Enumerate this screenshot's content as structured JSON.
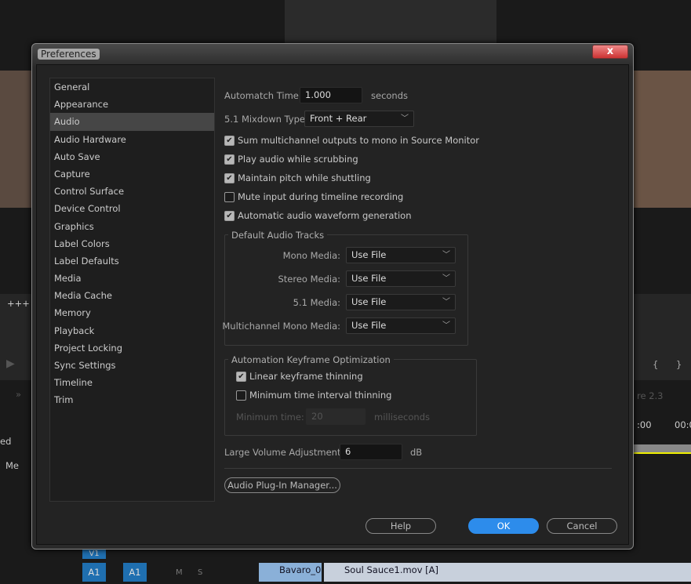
{
  "background": {
    "left_label": "ed",
    "column_header": "Me",
    "sequence_label": "re 2.3",
    "timecode1": ":00",
    "timecode2": "00:0",
    "track_a1": "A1",
    "track_a1_target": "A1",
    "track_v1": "V1",
    "mute": "M",
    "solo": "S",
    "clip1": "Bavaro_0",
    "clip2": "Soul Sauce1.mov [A]"
  },
  "dialog": {
    "title": "Preferences",
    "close": "x"
  },
  "sidebar": {
    "items": [
      "General",
      "Appearance",
      "Audio",
      "Audio Hardware",
      "Auto Save",
      "Capture",
      "Control Surface",
      "Device Control",
      "Graphics",
      "Label Colors",
      "Label Defaults",
      "Media",
      "Media Cache",
      "Memory",
      "Playback",
      "Project Locking",
      "Sync Settings",
      "Timeline",
      "Trim"
    ],
    "selected": "Audio"
  },
  "audio": {
    "automatch_label": "Automatch Time:",
    "automatch_value": "1.000",
    "automatch_unit": "seconds",
    "mixdown_label": "5.1 Mixdown Type:",
    "mixdown_value": "Front + Rear",
    "checks": [
      {
        "label": "Sum multichannel outputs to mono in Source Monitor",
        "checked": true
      },
      {
        "label": "Play audio while scrubbing",
        "checked": true
      },
      {
        "label": "Maintain pitch while shuttling",
        "checked": true
      },
      {
        "label": "Mute input during timeline recording",
        "checked": false
      },
      {
        "label": "Automatic audio waveform generation",
        "checked": true
      }
    ],
    "default_tracks": {
      "title": "Default Audio Tracks",
      "rows": [
        {
          "label": "Mono Media:",
          "value": "Use File"
        },
        {
          "label": "Stereo Media:",
          "value": "Use File"
        },
        {
          "label": "5.1 Media:",
          "value": "Use File"
        },
        {
          "label": "Multichannel Mono Media:",
          "value": "Use File"
        }
      ]
    },
    "keyframe": {
      "title": "Automation Keyframe Optimization",
      "linear": "Linear keyframe thinning",
      "linear_checked": true,
      "min_interval": "Minimum time interval thinning",
      "min_interval_checked": false,
      "min_time_label": "Minimum time:",
      "min_time_value": "20",
      "min_time_unit": "milliseconds"
    },
    "volume_label": "Large Volume Adjustment:",
    "volume_value": "6",
    "volume_unit": "dB",
    "plugin_button": "Audio Plug-In Manager..."
  },
  "buttons": {
    "help": "Help",
    "ok": "OK",
    "cancel": "Cancel"
  },
  "colors": {
    "accent": "#2d8ceb",
    "close": "#c33"
  }
}
